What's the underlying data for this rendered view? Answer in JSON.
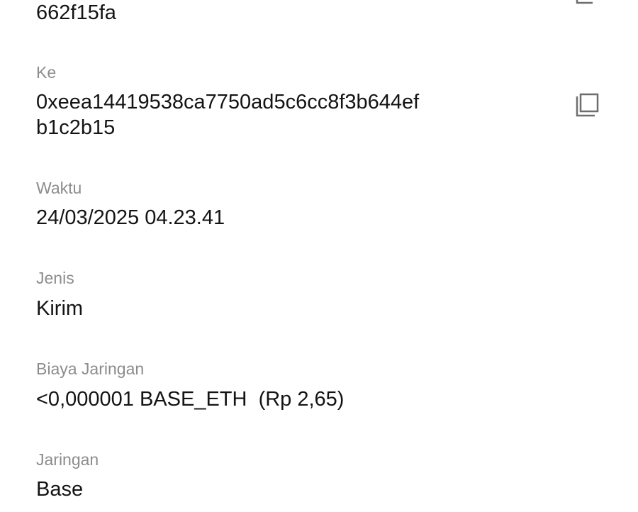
{
  "from": {
    "value_tail": "662f15fa",
    "copy_icon": "copy-icon"
  },
  "to": {
    "label": "Ke",
    "address_line1": "0xeea14419538ca7750ad5c6cc8f3b644ef",
    "address_line2": "b1c2b15",
    "copy_icon": "copy-icon"
  },
  "time": {
    "label": "Waktu",
    "value": "24/03/2025 04.23.41"
  },
  "type": {
    "label": "Jenis",
    "value": "Kirim"
  },
  "fee": {
    "label": "Biaya Jaringan",
    "value": "<0,000001 BASE_ETH  (Rp 2,65)"
  },
  "network": {
    "label": "Jaringan",
    "value": "Base"
  }
}
